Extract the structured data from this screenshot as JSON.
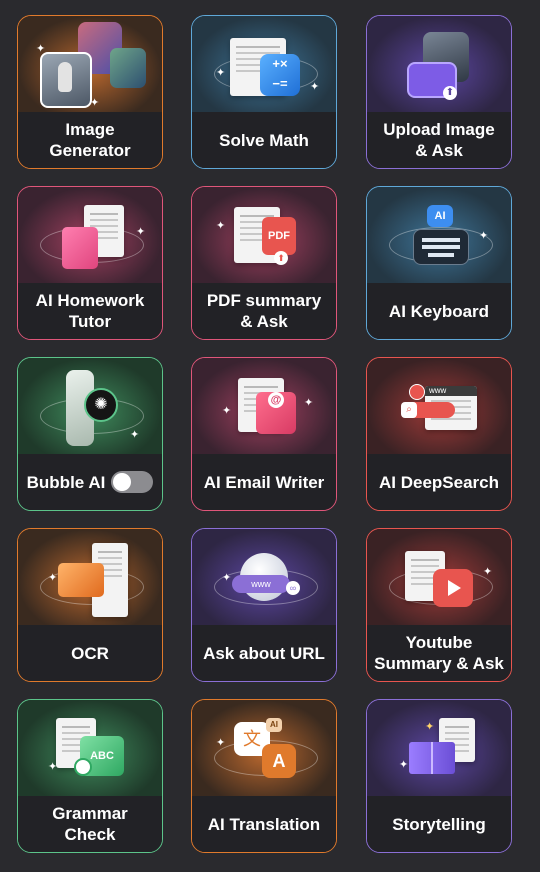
{
  "colors": {
    "orange": "#e07a2c",
    "blue": "#5fa8d8",
    "purple": "#8b6fd6",
    "pink": "#e0567a",
    "green": "#5cc48a",
    "red": "#e8554f"
  },
  "tools": [
    {
      "id": "image-generator",
      "label": "Image\nGenerator",
      "icon": "image-generator-icon"
    },
    {
      "id": "solve-math",
      "label": "Solve Math",
      "icon": "calculator-icon"
    },
    {
      "id": "upload-image-ask",
      "label": "Upload Image\n& Ask",
      "icon": "upload-image-icon"
    },
    {
      "id": "ai-homework-tutor",
      "label": "AI Homework\nTutor",
      "icon": "notebook-pencil-icon"
    },
    {
      "id": "pdf-summary-ask",
      "label": "PDF summary\n& Ask",
      "icon": "pdf-icon",
      "icon_text": "PDF"
    },
    {
      "id": "ai-keyboard",
      "label": "AI Keyboard",
      "icon": "keyboard-icon",
      "icon_text": "AI"
    },
    {
      "id": "bubble-ai",
      "label": "Bubble AI",
      "icon": "phone-bubble-icon",
      "toggle_on": false
    },
    {
      "id": "ai-email-writer",
      "label": "AI Email Writer",
      "icon": "email-icon"
    },
    {
      "id": "ai-deepsearch",
      "label": "AI DeepSearch",
      "icon": "browser-search-icon",
      "icon_text": "www"
    },
    {
      "id": "ocr",
      "label": "OCR",
      "icon": "ocr-scan-icon"
    },
    {
      "id": "ask-about-url",
      "label": "Ask about URL",
      "icon": "globe-link-icon",
      "icon_text": "www"
    },
    {
      "id": "youtube-summary-ask",
      "label": "Youtube\nSummary & Ask",
      "icon": "youtube-play-icon"
    },
    {
      "id": "grammar-check",
      "label": "Grammar\nCheck",
      "icon": "grammar-abc-icon",
      "icon_text": "ABC"
    },
    {
      "id": "ai-translation",
      "label": "AI Translation",
      "icon": "translate-icon",
      "icon_text_a": "文",
      "icon_text_b": "A",
      "icon_text_c": "AI"
    },
    {
      "id": "storytelling",
      "label": "Storytelling",
      "icon": "open-book-icon"
    }
  ]
}
